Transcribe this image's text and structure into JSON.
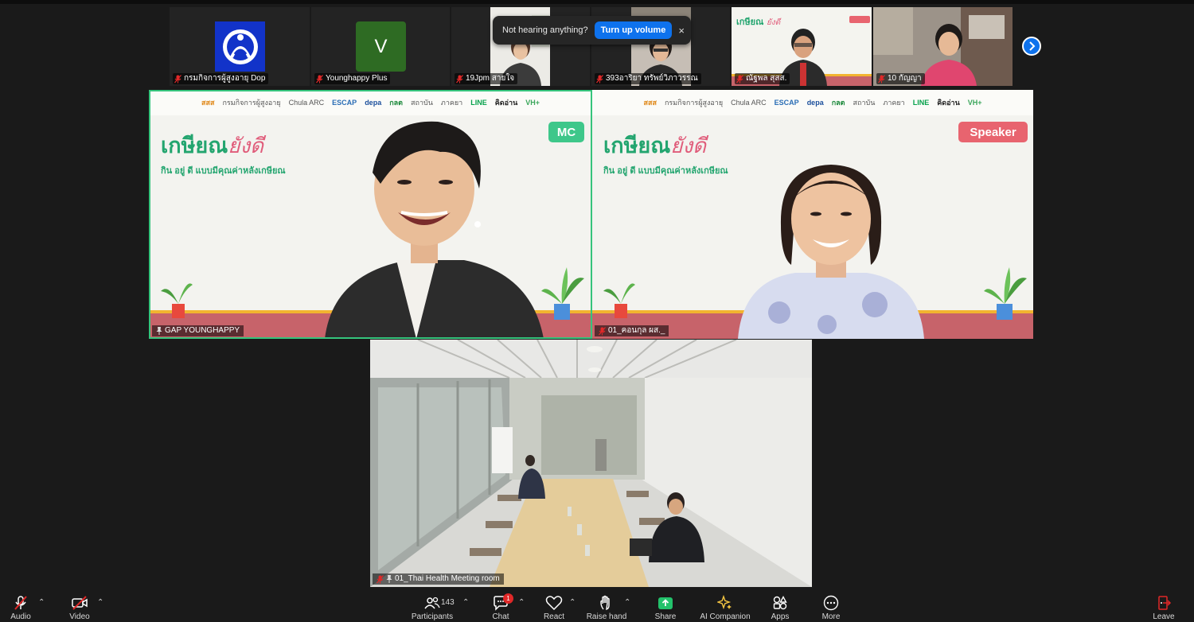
{
  "notification": {
    "text": "Not hearing anything?",
    "button": "Turn up volume",
    "close": "×"
  },
  "thumbnails": [
    {
      "name": "กรมกิจการผู้สูงอายุ Dop",
      "type": "logo"
    },
    {
      "name": "Younghappy Plus",
      "type": "avatar",
      "initial": "V"
    },
    {
      "name": "19Jpm สายใจ",
      "type": "video"
    },
    {
      "name": "393อาริยา ทรัพย์วิภาวรรณ",
      "type": "video"
    },
    {
      "name": "ณัฐพล  สุสส.",
      "type": "video"
    },
    {
      "name": "10 กัญญา",
      "type": "video"
    }
  ],
  "speakers": [
    {
      "name": "GAP YOUNGHAPPY",
      "role": "MC"
    },
    {
      "name": "01_คอนกุล ผส._",
      "role": "Speaker"
    }
  ],
  "event_brand": {
    "title": "เกษียณ",
    "title_accent": "ยังดี",
    "subtitle": "กิน อยู่ ดี แบบมีคุณค่าหลังเกษียณ",
    "logos": [
      "สสส",
      "กรมกิจการผู้สูงอายุ",
      "Chula ARC",
      "ESCAP",
      "depa",
      "กลต",
      "สถาบัน",
      "ภาคยา",
      "LINE",
      "คิดอ่าน",
      "VH+"
    ]
  },
  "room_tile": {
    "name": "01_Thai Health Meeting room"
  },
  "toolbar": {
    "audio": "Audio",
    "video": "Video",
    "participants": "Participants",
    "participant_count": "143",
    "chat": "Chat",
    "chat_badge": "1",
    "react": "React",
    "raise_hand": "Raise hand",
    "share": "Share",
    "ai_companion": "AI Companion",
    "apps": "Apps",
    "more": "More",
    "leave": "Leave"
  },
  "colors": {
    "accent_blue": "#0e72ed",
    "active_speaker": "#35c47c",
    "mc_badge": "#3ec78a",
    "speaker_badge": "#e8646f",
    "share_green": "#23c26b",
    "leave_red": "#e02828"
  }
}
